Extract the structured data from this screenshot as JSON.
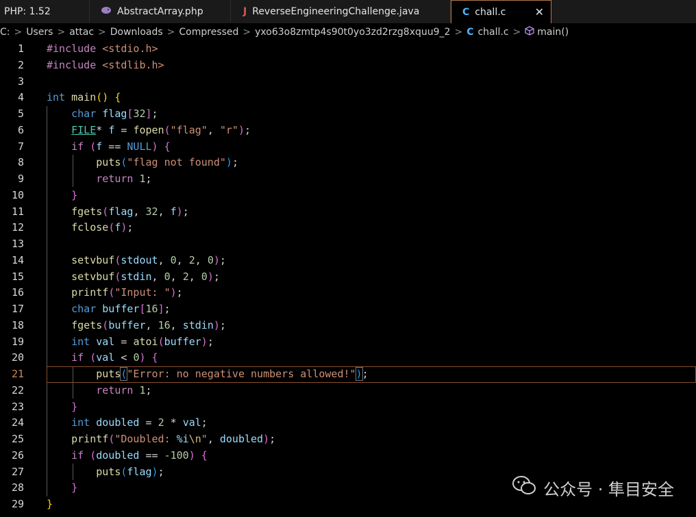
{
  "tabs": [
    {
      "icon": "",
      "label": "PHP: 1.52"
    },
    {
      "icon": "php-elephant",
      "label": "AbstractArray.php"
    },
    {
      "icon": "J",
      "label": "ReverseEngineeringChallenge.java"
    },
    {
      "icon": "C",
      "label": "chall.c",
      "close": "✕"
    }
  ],
  "breadcrumb": {
    "segments": [
      "C:",
      "Users",
      "attac",
      "Downloads",
      "Compressed",
      "yxo63o8zmtp4s90t0yo3zd2rzg8xquu9_2"
    ],
    "file_icon": "C",
    "file": "chall.c",
    "symbol": "main()"
  },
  "editor": {
    "current_line": 21,
    "lines": [
      {
        "n": "1",
        "text": "#include <stdio.h>"
      },
      {
        "n": "2",
        "text": "#include <stdlib.h>"
      },
      {
        "n": "3",
        "text": ""
      },
      {
        "n": "4",
        "text": "int main() {"
      },
      {
        "n": "5",
        "text": "char flag[32];"
      },
      {
        "n": "6",
        "text": "FILE* f = fopen(\"flag\", \"r\");"
      },
      {
        "n": "7",
        "text": "if (f == NULL) {"
      },
      {
        "n": "8",
        "text": "puts(\"flag not found\");"
      },
      {
        "n": "9",
        "text": "return 1;"
      },
      {
        "n": "10",
        "text": "}"
      },
      {
        "n": "11",
        "text": "fgets(flag, 32, f);"
      },
      {
        "n": "12",
        "text": "fclose(f);"
      },
      {
        "n": "13",
        "text": ""
      },
      {
        "n": "14",
        "text": "setvbuf(stdout, 0, 2, 0);"
      },
      {
        "n": "15",
        "text": "setvbuf(stdin, 0, 2, 0);"
      },
      {
        "n": "16",
        "text": "printf(\"Input: \");"
      },
      {
        "n": "17",
        "text": "char buffer[16];"
      },
      {
        "n": "18",
        "text": "fgets(buffer, 16, stdin);"
      },
      {
        "n": "19",
        "text": "int val = atoi(buffer);"
      },
      {
        "n": "20",
        "text": "if (val < 0) {"
      },
      {
        "n": "21",
        "text": "puts(\"Error: no negative numbers allowed!\");"
      },
      {
        "n": "22",
        "text": "return 1;"
      },
      {
        "n": "23",
        "text": "}"
      },
      {
        "n": "24",
        "text": "int doubled = 2 * val;"
      },
      {
        "n": "25",
        "text": "printf(\"Doubled: %i\\n\", doubled);"
      },
      {
        "n": "26",
        "text": "if (doubled == -100) {"
      },
      {
        "n": "27",
        "text": "puts(flag);"
      },
      {
        "n": "28",
        "text": "}"
      },
      {
        "n": "29",
        "text": "}"
      }
    ]
  },
  "watermark": {
    "icon": "wechat-icon",
    "text": "公众号 · 隼目安全"
  }
}
